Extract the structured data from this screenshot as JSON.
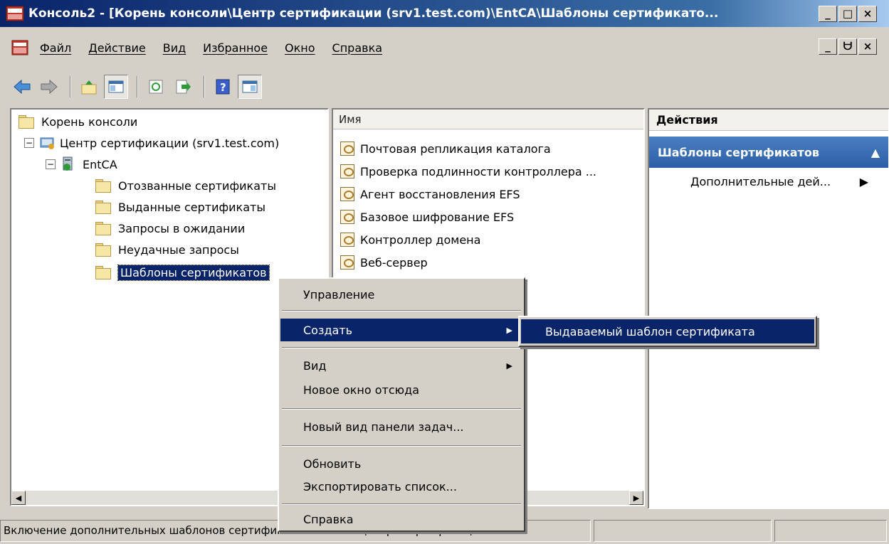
{
  "window": {
    "title": "Консоль2 - [Корень консоли\\Центр сертификации (srv1.test.com)\\EntCA\\Шаблоны сертификато...",
    "min": "_",
    "max": "□",
    "close": "×"
  },
  "menubar": {
    "items": [
      "Файл",
      "Действие",
      "Вид",
      "Избранное",
      "Окно",
      "Справка"
    ],
    "doc_min": "_",
    "doc_restore": "ᗨ",
    "doc_close": "×"
  },
  "tree": {
    "root": "Корень консоли",
    "ca": "Центр сертификации (srv1.test.com)",
    "entca": "EntCA",
    "children": [
      "Отозванные сертификаты",
      "Выданные сертификаты",
      "Запросы в ожидании",
      "Неудачные запросы",
      "Шаблоны сертификатов"
    ],
    "expander": "−"
  },
  "list": {
    "column": "Имя",
    "rows": [
      "Почтовая репликация каталога",
      "Проверка подлинности контроллера ...",
      "Агент восстановления EFS",
      "Базовое шифрование EFS",
      "Контроллер домена",
      "Веб-сервер"
    ]
  },
  "actions": {
    "header": "Действия",
    "group": "Шаблоны сертификатов",
    "group_arrow": "▲",
    "item": "Дополнительные дей...",
    "item_arrow": "▶"
  },
  "context_menu": {
    "manage": "Управление",
    "create": "Создать",
    "view": "Вид",
    "new_window": "Новое окно отсюда",
    "new_taskpad": "Новый вид панели задач...",
    "refresh": "Обновить",
    "export": "Экспортировать список...",
    "help": "Справка",
    "arrow": "▶"
  },
  "submenu": {
    "item": "Выдаваемый шаблон сертификата"
  },
  "statusbar": {
    "text": "Включение дополнительных шаблонов сертификатов на этом центре сертификац"
  },
  "scroll": {
    "left": "◀",
    "right": "▶"
  }
}
